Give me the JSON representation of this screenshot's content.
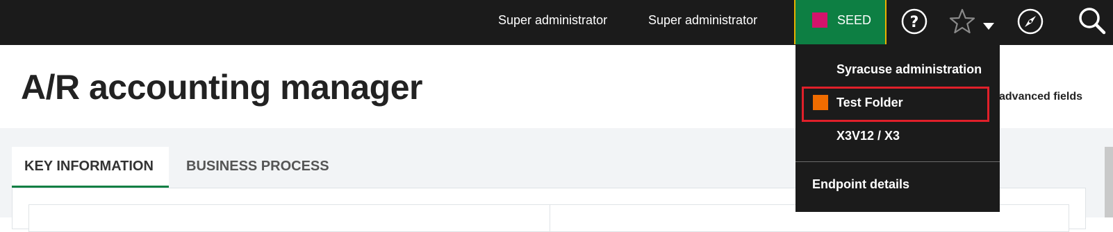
{
  "topbar": {
    "user_name_1": "Super administrator",
    "user_name_2": "Super administrator",
    "endpoint": {
      "label": "SEED",
      "color": "#d4136b"
    },
    "icons": [
      "help-icon",
      "star-icon",
      "chevron-down-icon",
      "compass-icon",
      "search-icon"
    ],
    "accent_color": "#0d7f43"
  },
  "page": {
    "title": "A/R accounting manager",
    "advanced_fields_label": "advanced fields"
  },
  "tabs": [
    {
      "label": "KEY INFORMATION",
      "active": true
    },
    {
      "label": "BUSINESS PROCESS",
      "active": false
    }
  ],
  "dropdown": {
    "items": [
      {
        "label": "Syracuse administration",
        "color": null
      },
      {
        "label": "Test Folder",
        "color": "#f06c00",
        "highlighted": true
      },
      {
        "label": "X3V12 / X3",
        "color": null
      }
    ],
    "endpoint_details_label": "Endpoint details",
    "highlight_color": "#e0202a"
  }
}
